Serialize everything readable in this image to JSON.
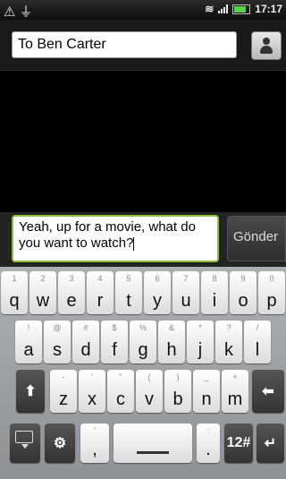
{
  "status_bar": {
    "left_icons": [
      "alert-icon",
      "usb-icon"
    ],
    "time": "17:17"
  },
  "header": {
    "to_value": "To Ben  Carter",
    "contact_icon": "person-icon"
  },
  "compose": {
    "message_text": "Yeah, up for a movie, what do you want to watch?",
    "send_label": "Gönder"
  },
  "keyboard": {
    "row1": [
      {
        "main": "q",
        "alt": "1"
      },
      {
        "main": "w",
        "alt": "2"
      },
      {
        "main": "e",
        "alt": "3"
      },
      {
        "main": "r",
        "alt": "4"
      },
      {
        "main": "t",
        "alt": "5"
      },
      {
        "main": "y",
        "alt": "6"
      },
      {
        "main": "u",
        "alt": "7"
      },
      {
        "main": "i",
        "alt": "8"
      },
      {
        "main": "o",
        "alt": "9"
      },
      {
        "main": "p",
        "alt": "0"
      }
    ],
    "row2": [
      {
        "main": "a",
        "alt": "!"
      },
      {
        "main": "s",
        "alt": "@"
      },
      {
        "main": "d",
        "alt": "#"
      },
      {
        "main": "f",
        "alt": "$"
      },
      {
        "main": "g",
        "alt": "%"
      },
      {
        "main": "h",
        "alt": "&"
      },
      {
        "main": "j",
        "alt": "*"
      },
      {
        "main": "k",
        "alt": "?"
      },
      {
        "main": "l",
        "alt": "/"
      }
    ],
    "row3": [
      {
        "main": "z",
        "alt": "-"
      },
      {
        "main": "x",
        "alt": "'"
      },
      {
        "main": "c",
        "alt": "\""
      },
      {
        "main": "v",
        "alt": "("
      },
      {
        "main": "b",
        "alt": ")"
      },
      {
        "main": "n",
        "alt": "_"
      },
      {
        "main": "m",
        "alt": "+"
      }
    ],
    "shift_glyph": "⬆",
    "backspace_glyph": "⬅",
    "settings_glyph": "⚙",
    "comma_key": {
      "main": ",",
      "alt": "'"
    },
    "period_key": {
      "main": ".",
      "alt": ":"
    },
    "symbols_label": "12#",
    "enter_glyph": "↵"
  }
}
